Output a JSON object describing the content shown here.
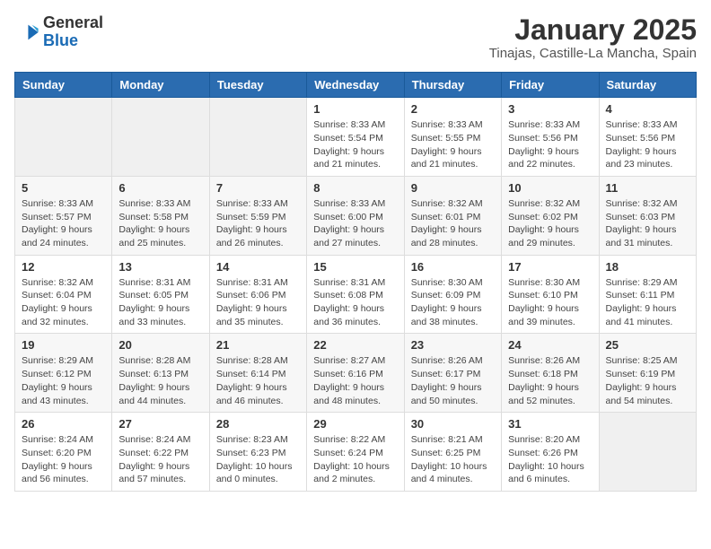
{
  "logo": {
    "general": "General",
    "blue": "Blue"
  },
  "title": "January 2025",
  "subtitle": "Tinajas, Castille-La Mancha, Spain",
  "weekdays": [
    "Sunday",
    "Monday",
    "Tuesday",
    "Wednesday",
    "Thursday",
    "Friday",
    "Saturday"
  ],
  "weeks": [
    [
      {
        "day": "",
        "sunrise": "",
        "sunset": "",
        "daylight": ""
      },
      {
        "day": "",
        "sunrise": "",
        "sunset": "",
        "daylight": ""
      },
      {
        "day": "",
        "sunrise": "",
        "sunset": "",
        "daylight": ""
      },
      {
        "day": "1",
        "sunrise": "Sunrise: 8:33 AM",
        "sunset": "Sunset: 5:54 PM",
        "daylight": "Daylight: 9 hours and 21 minutes."
      },
      {
        "day": "2",
        "sunrise": "Sunrise: 8:33 AM",
        "sunset": "Sunset: 5:55 PM",
        "daylight": "Daylight: 9 hours and 21 minutes."
      },
      {
        "day": "3",
        "sunrise": "Sunrise: 8:33 AM",
        "sunset": "Sunset: 5:56 PM",
        "daylight": "Daylight: 9 hours and 22 minutes."
      },
      {
        "day": "4",
        "sunrise": "Sunrise: 8:33 AM",
        "sunset": "Sunset: 5:56 PM",
        "daylight": "Daylight: 9 hours and 23 minutes."
      }
    ],
    [
      {
        "day": "5",
        "sunrise": "Sunrise: 8:33 AM",
        "sunset": "Sunset: 5:57 PM",
        "daylight": "Daylight: 9 hours and 24 minutes."
      },
      {
        "day": "6",
        "sunrise": "Sunrise: 8:33 AM",
        "sunset": "Sunset: 5:58 PM",
        "daylight": "Daylight: 9 hours and 25 minutes."
      },
      {
        "day": "7",
        "sunrise": "Sunrise: 8:33 AM",
        "sunset": "Sunset: 5:59 PM",
        "daylight": "Daylight: 9 hours and 26 minutes."
      },
      {
        "day": "8",
        "sunrise": "Sunrise: 8:33 AM",
        "sunset": "Sunset: 6:00 PM",
        "daylight": "Daylight: 9 hours and 27 minutes."
      },
      {
        "day": "9",
        "sunrise": "Sunrise: 8:32 AM",
        "sunset": "Sunset: 6:01 PM",
        "daylight": "Daylight: 9 hours and 28 minutes."
      },
      {
        "day": "10",
        "sunrise": "Sunrise: 8:32 AM",
        "sunset": "Sunset: 6:02 PM",
        "daylight": "Daylight: 9 hours and 29 minutes."
      },
      {
        "day": "11",
        "sunrise": "Sunrise: 8:32 AM",
        "sunset": "Sunset: 6:03 PM",
        "daylight": "Daylight: 9 hours and 31 minutes."
      }
    ],
    [
      {
        "day": "12",
        "sunrise": "Sunrise: 8:32 AM",
        "sunset": "Sunset: 6:04 PM",
        "daylight": "Daylight: 9 hours and 32 minutes."
      },
      {
        "day": "13",
        "sunrise": "Sunrise: 8:31 AM",
        "sunset": "Sunset: 6:05 PM",
        "daylight": "Daylight: 9 hours and 33 minutes."
      },
      {
        "day": "14",
        "sunrise": "Sunrise: 8:31 AM",
        "sunset": "Sunset: 6:06 PM",
        "daylight": "Daylight: 9 hours and 35 minutes."
      },
      {
        "day": "15",
        "sunrise": "Sunrise: 8:31 AM",
        "sunset": "Sunset: 6:08 PM",
        "daylight": "Daylight: 9 hours and 36 minutes."
      },
      {
        "day": "16",
        "sunrise": "Sunrise: 8:30 AM",
        "sunset": "Sunset: 6:09 PM",
        "daylight": "Daylight: 9 hours and 38 minutes."
      },
      {
        "day": "17",
        "sunrise": "Sunrise: 8:30 AM",
        "sunset": "Sunset: 6:10 PM",
        "daylight": "Daylight: 9 hours and 39 minutes."
      },
      {
        "day": "18",
        "sunrise": "Sunrise: 8:29 AM",
        "sunset": "Sunset: 6:11 PM",
        "daylight": "Daylight: 9 hours and 41 minutes."
      }
    ],
    [
      {
        "day": "19",
        "sunrise": "Sunrise: 8:29 AM",
        "sunset": "Sunset: 6:12 PM",
        "daylight": "Daylight: 9 hours and 43 minutes."
      },
      {
        "day": "20",
        "sunrise": "Sunrise: 8:28 AM",
        "sunset": "Sunset: 6:13 PM",
        "daylight": "Daylight: 9 hours and 44 minutes."
      },
      {
        "day": "21",
        "sunrise": "Sunrise: 8:28 AM",
        "sunset": "Sunset: 6:14 PM",
        "daylight": "Daylight: 9 hours and 46 minutes."
      },
      {
        "day": "22",
        "sunrise": "Sunrise: 8:27 AM",
        "sunset": "Sunset: 6:16 PM",
        "daylight": "Daylight: 9 hours and 48 minutes."
      },
      {
        "day": "23",
        "sunrise": "Sunrise: 8:26 AM",
        "sunset": "Sunset: 6:17 PM",
        "daylight": "Daylight: 9 hours and 50 minutes."
      },
      {
        "day": "24",
        "sunrise": "Sunrise: 8:26 AM",
        "sunset": "Sunset: 6:18 PM",
        "daylight": "Daylight: 9 hours and 52 minutes."
      },
      {
        "day": "25",
        "sunrise": "Sunrise: 8:25 AM",
        "sunset": "Sunset: 6:19 PM",
        "daylight": "Daylight: 9 hours and 54 minutes."
      }
    ],
    [
      {
        "day": "26",
        "sunrise": "Sunrise: 8:24 AM",
        "sunset": "Sunset: 6:20 PM",
        "daylight": "Daylight: 9 hours and 56 minutes."
      },
      {
        "day": "27",
        "sunrise": "Sunrise: 8:24 AM",
        "sunset": "Sunset: 6:22 PM",
        "daylight": "Daylight: 9 hours and 57 minutes."
      },
      {
        "day": "28",
        "sunrise": "Sunrise: 8:23 AM",
        "sunset": "Sunset: 6:23 PM",
        "daylight": "Daylight: 10 hours and 0 minutes."
      },
      {
        "day": "29",
        "sunrise": "Sunrise: 8:22 AM",
        "sunset": "Sunset: 6:24 PM",
        "daylight": "Daylight: 10 hours and 2 minutes."
      },
      {
        "day": "30",
        "sunrise": "Sunrise: 8:21 AM",
        "sunset": "Sunset: 6:25 PM",
        "daylight": "Daylight: 10 hours and 4 minutes."
      },
      {
        "day": "31",
        "sunrise": "Sunrise: 8:20 AM",
        "sunset": "Sunset: 6:26 PM",
        "daylight": "Daylight: 10 hours and 6 minutes."
      },
      {
        "day": "",
        "sunrise": "",
        "sunset": "",
        "daylight": ""
      }
    ]
  ]
}
